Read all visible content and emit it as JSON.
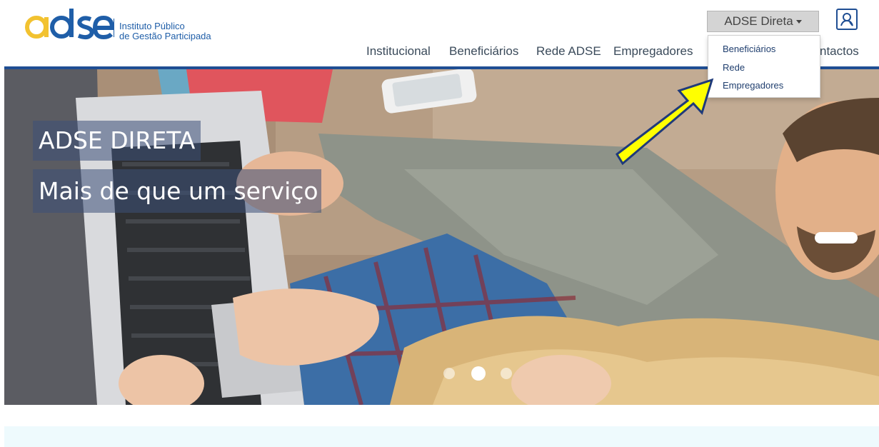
{
  "logo": {
    "wordmark": "adse",
    "line1": "Instituto Público",
    "line2": "de Gestão Participada",
    "colors": {
      "blue": "#1f5ea8",
      "yellow": "#f2c230"
    }
  },
  "nav": {
    "items": [
      {
        "label": "Institucional"
      },
      {
        "label": "Beneficiários"
      },
      {
        "label": "Rede ADSE"
      },
      {
        "label": "Empregadores"
      },
      {
        "label": "ntactos"
      }
    ]
  },
  "direta_button": {
    "label": "ADSE Direta"
  },
  "login_icon": "user-login-icon",
  "dropdown": {
    "items": [
      {
        "label": "Beneficiários"
      },
      {
        "label": "Rede"
      },
      {
        "label": "Empregadores"
      }
    ]
  },
  "hero": {
    "title": "ADSE DIRETA",
    "subtitle": "Mais de que um serviço",
    "slides": {
      "count": 3,
      "active": 2
    }
  },
  "annotation": {
    "type": "arrow",
    "color": "#ffff00"
  }
}
